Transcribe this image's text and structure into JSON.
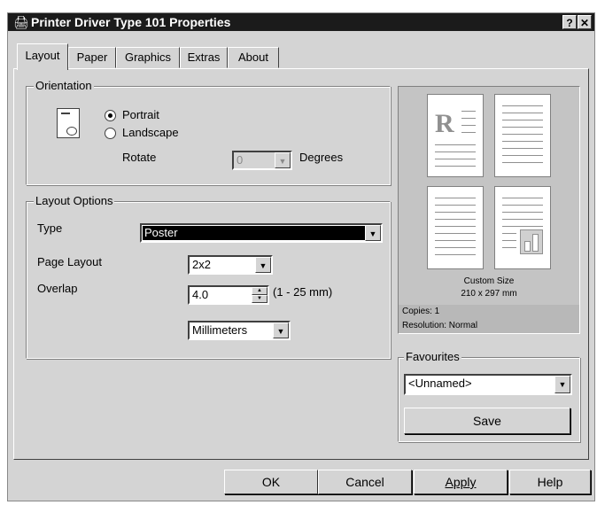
{
  "window": {
    "title": "Printer Driver Type 101 Properties",
    "help_btn": "?",
    "close_btn": "✕"
  },
  "tabs": [
    "Layout",
    "Paper",
    "Graphics",
    "Extras",
    "About"
  ],
  "orientation": {
    "legend": "Orientation",
    "portrait": "Portrait",
    "landscape": "Landscape",
    "selected": "Portrait",
    "rotate_label": "Rotate",
    "rotate_value": "0",
    "degrees_label": "Degrees"
  },
  "layout_options": {
    "legend": "Layout Options",
    "type_label": "Type",
    "type_value": "Poster",
    "page_layout_label": "Page Layout",
    "page_layout_value": "2x2",
    "overlap_label": "Overlap",
    "overlap_value": "4.0",
    "overlap_range": "(1 - 25 mm)",
    "units_value": "Millimeters"
  },
  "preview": {
    "letter": "R",
    "size_name": "Custom Size",
    "size_dims": "210 x 297 mm",
    "copies": "Copies: 1",
    "resolution": "Resolution: Normal"
  },
  "favourites": {
    "legend": "Favourites",
    "value": "<Unnamed>",
    "save": "Save"
  },
  "buttons": {
    "ok": "OK",
    "cancel": "Cancel",
    "apply": "Apply",
    "help": "Help"
  }
}
